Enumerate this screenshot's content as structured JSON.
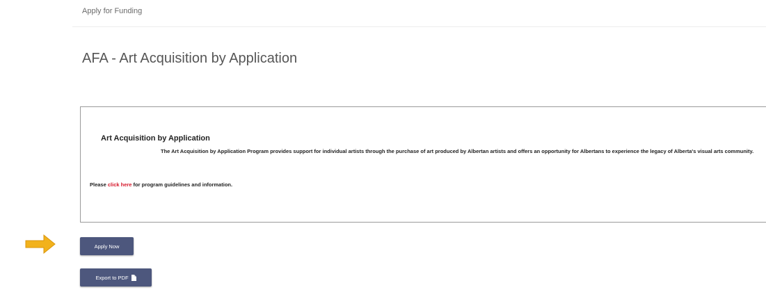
{
  "breadcrumb": "Apply for Funding",
  "page_title": "AFA - Art Acquisition by Application",
  "info_box": {
    "heading": "Art Acquisition by Application",
    "body": "The Art Acquisition by Application Program provides support for individual artists through the purchase of art produced by Albertan artists and offers an opportunity for Albertans to experience the legacy of Alberta's visual arts community.",
    "link_prefix": "Please ",
    "link_text": "click here",
    "link_suffix": " for program guidelines and information."
  },
  "buttons": {
    "apply_label": "Apply Now",
    "export_label": "Export to PDF"
  },
  "icons": {
    "pdf": "file-icon",
    "arrow": "arrow-right-icon"
  },
  "colors": {
    "button_bg": "#4d577d",
    "link": "#d6182b",
    "arrow": "#f2b21c"
  }
}
